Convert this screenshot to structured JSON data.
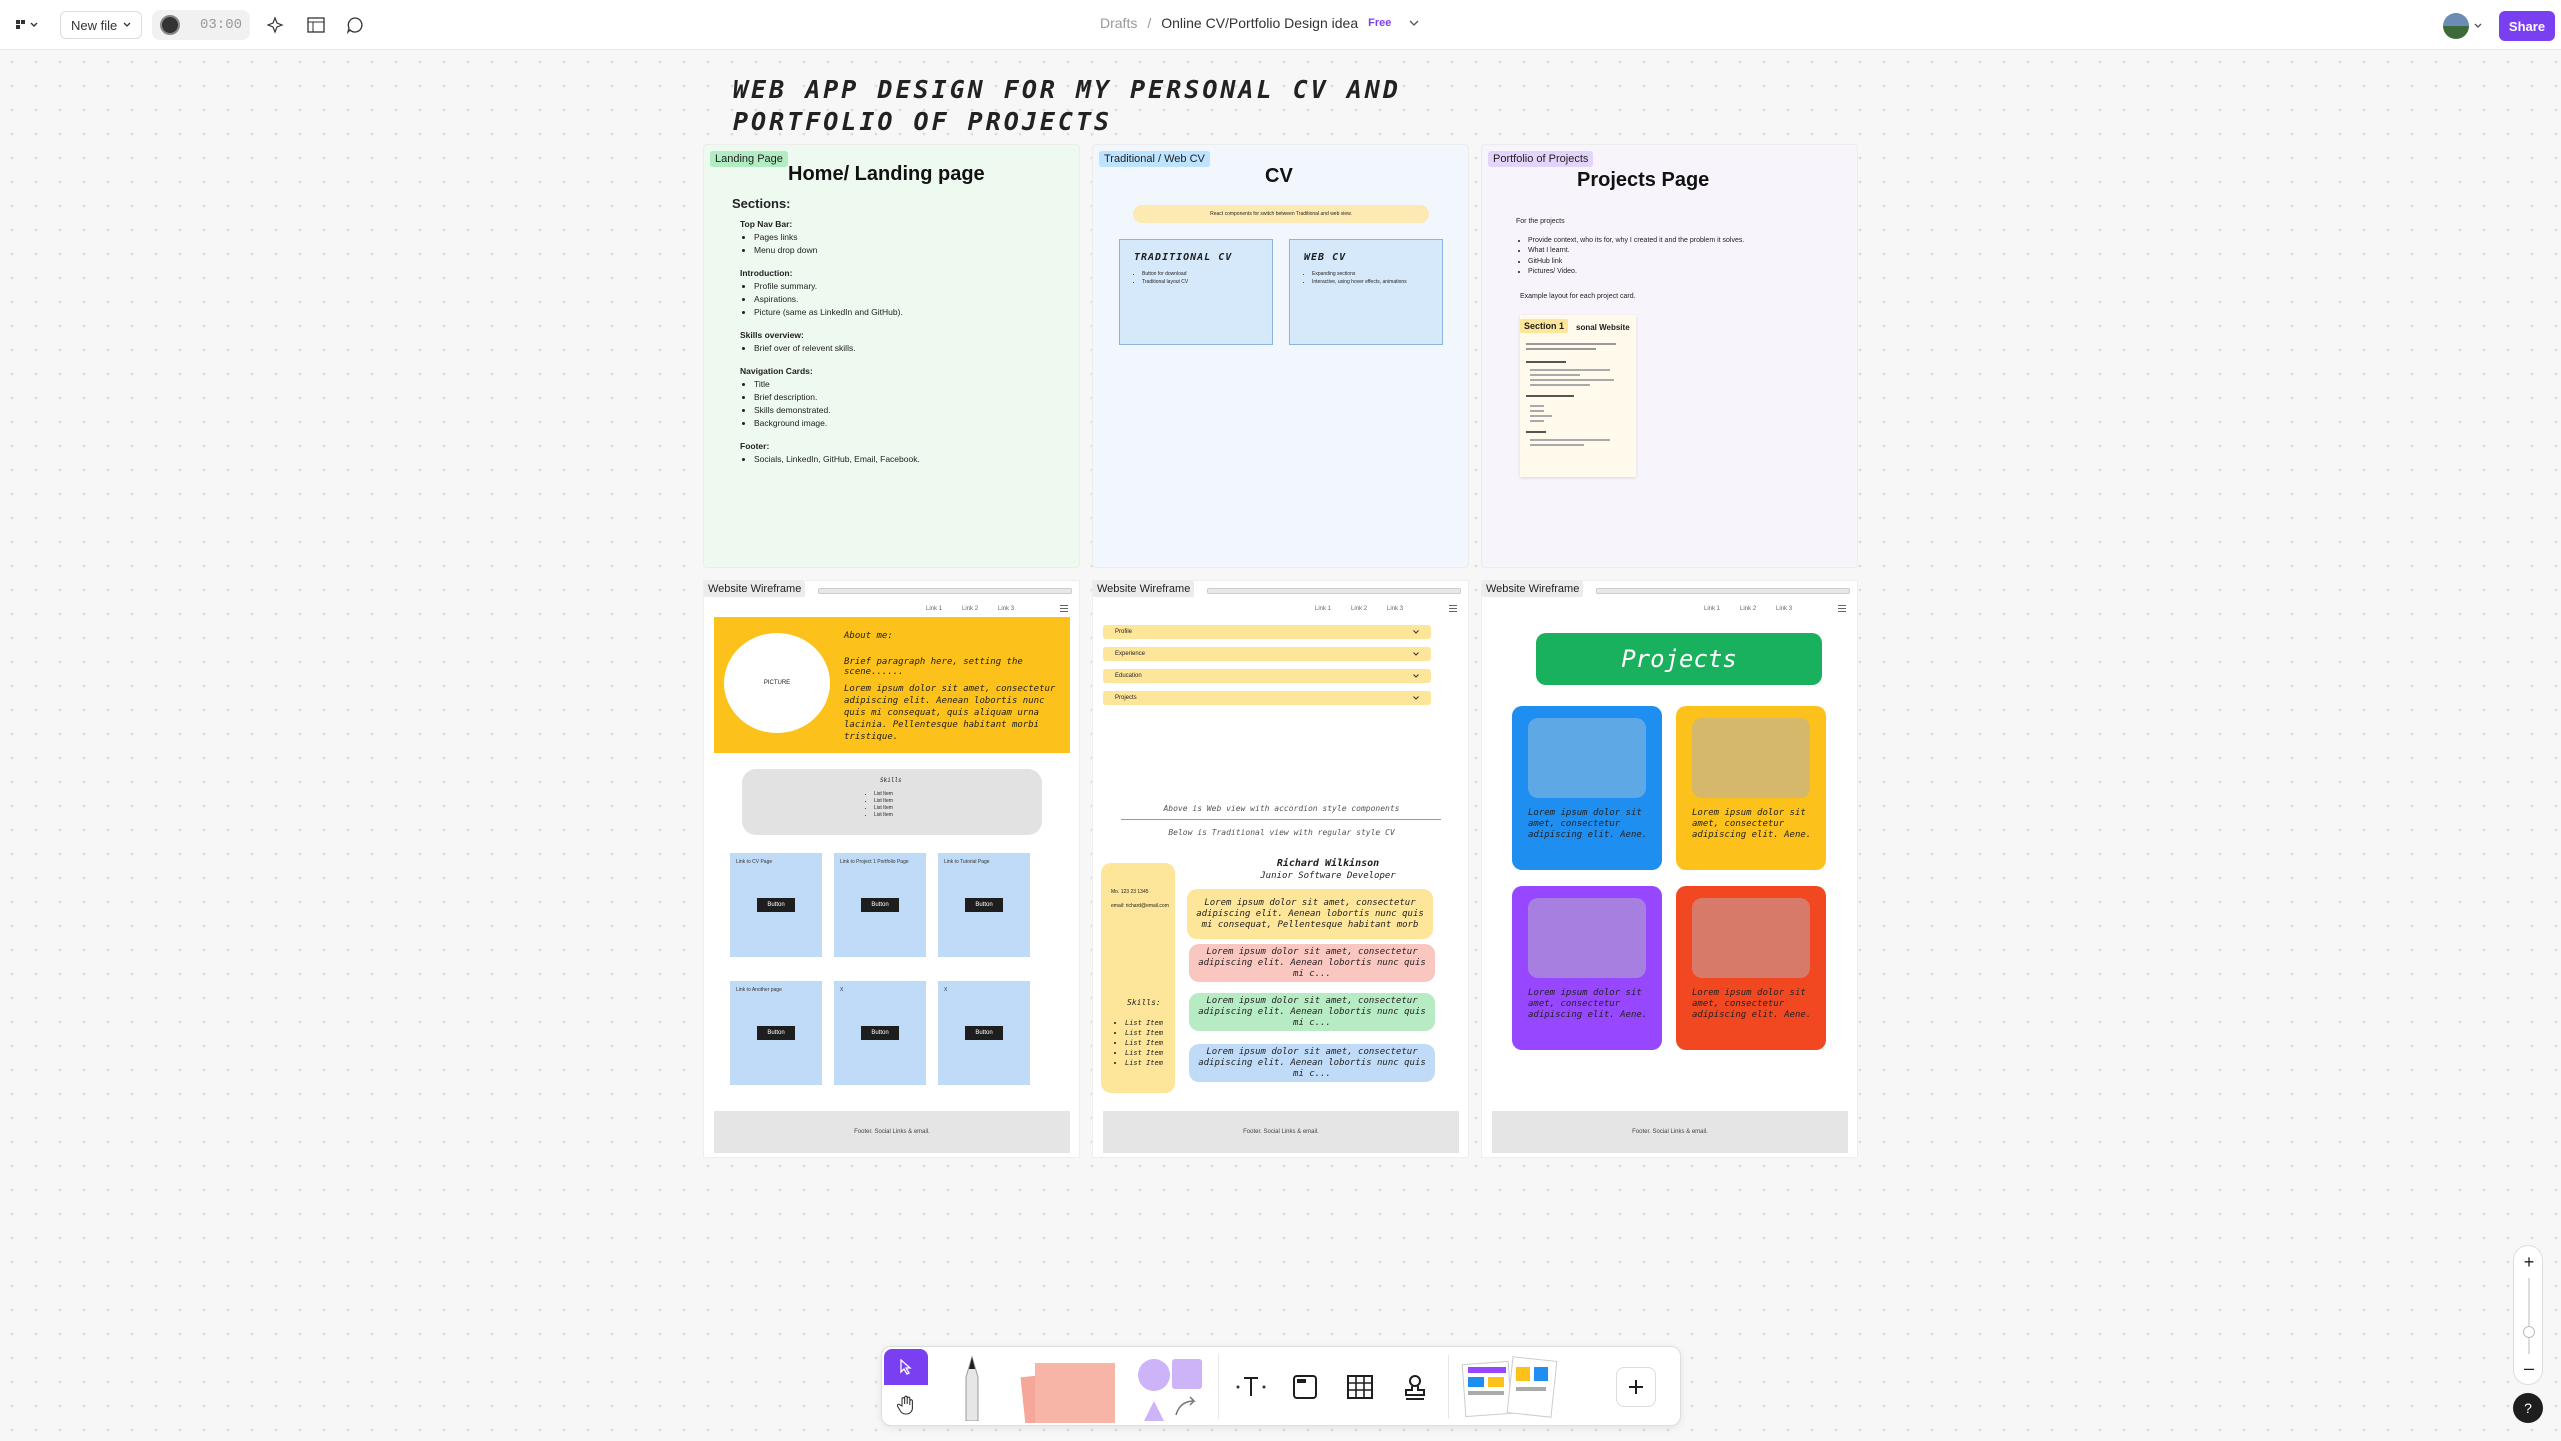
{
  "topbar": {
    "new_file_label": "New file",
    "timer": "03:00",
    "breadcrumb_root": "Drafts",
    "breadcrumb_sep": "/",
    "file_name": "Online CV/Portfolio Design idea",
    "plan_badge": "Free",
    "share_label": "Share"
  },
  "canvas": {
    "title": "WEB APP DESIGN FOR MY PERSONAL CV AND PORTFOLIO OF PROJECTS",
    "landing": {
      "tag": "Landing Page",
      "title": "Home/ Landing page",
      "sections_heading": "Sections:",
      "groups": [
        {
          "heading": "Top Nav Bar:",
          "items": [
            "Pages links",
            "Menu drop down"
          ]
        },
        {
          "heading": "Introduction:",
          "items": [
            "Profile summary.",
            "Aspirations.",
            "Picture (same as LinkedIn and GitHub)."
          ]
        },
        {
          "heading": "Skills overview:",
          "items": [
            "Brief over of relevent skills."
          ]
        },
        {
          "heading": "Navigation Cards:",
          "items": [
            "Title",
            "Brief description.",
            "Skills demonstrated.",
            "Background image."
          ]
        },
        {
          "heading": "Footer:",
          "items": [
            "Socials, LinkedIn, GitHub, Email, Facebook."
          ]
        }
      ]
    },
    "cv": {
      "tag": "Traditional / Web CV",
      "title": "CV",
      "banner": "React components for switch between Traditional and web view.",
      "traditional": {
        "title": "TRADITIONAL CV",
        "items": [
          "Button for download",
          "Traditional layout CV"
        ]
      },
      "web": {
        "title": "WEB CV",
        "items": [
          "Expanding sections",
          "Interactive, using hover effects, animations"
        ]
      }
    },
    "projects": {
      "tag": "Portfolio of Projects",
      "title": "Projects Page",
      "intro": "For the projects",
      "items": [
        "Provide context, who its for, why I created it and the problem it solves.",
        "What I learnt.",
        "GitHub link",
        "Pictures/ Video."
      ],
      "example": "Example layout for each project card.",
      "card_tag": "Section 1",
      "card_title": "sonal Website"
    },
    "wf_home": {
      "tag": "Website Wireframe",
      "links": [
        "Link 1",
        "Link 2",
        "Link 3"
      ],
      "picture": "PICTURE",
      "about_title": "About me:",
      "about_line": "Brief paragraph here, setting the scene......",
      "lorem": "Lorem ipsum dolor sit amet, consectetur adipiscing elit. Aenean lobortis nunc quis mi consequat, quis aliquam urna lacinia. Pellentesque habitant morbi tristique.",
      "skills_title": "Skills",
      "skills": [
        "List Item",
        "List Item",
        "List Item",
        "List Item"
      ],
      "cards": [
        {
          "label": "Link to CV Page",
          "button": "Button"
        },
        {
          "label": "Link to Project 1 Portfolio Page",
          "button": "Button"
        },
        {
          "label": "Link to Tutorial Page",
          "button": "Button"
        },
        {
          "label": "Link to Another page",
          "button": "Button"
        },
        {
          "label": "X",
          "button": "Button"
        },
        {
          "label": "X",
          "button": "Button"
        }
      ],
      "footer": "Footer. Social Links & email."
    },
    "wf_cv": {
      "tag": "Website Wireframe",
      "links": [
        "Link 1",
        "Link 2",
        "Link 3"
      ],
      "accordion": [
        "Profile",
        "Experience",
        "Education",
        "Projects"
      ],
      "note_above": "Above is Web view with accordion style components",
      "note_below": "Below is Traditional view with regular style CV",
      "name": "Richard Wilkinson",
      "role": "Junior Software Developer",
      "phone": "Mo. 123 23 1345",
      "email": "email: richard@email.com",
      "skills_title": "Skills:",
      "skills": [
        "List Item",
        "List Item",
        "List Item",
        "List Item",
        "List Item"
      ],
      "blocks": [
        "Lorem ipsum dolor sit amet, consectetur adipiscing elit. Aenean lobortis nunc quis mi consequat, Pellentesque habitant morb",
        "Lorem ipsum dolor sit amet, consectetur adipiscing elit. Aenean lobortis nunc quis mi c...",
        "Lorem ipsum dolor sit amet, consectetur adipiscing elit. Aenean lobortis nunc quis mi c...",
        "Lorem ipsum dolor sit amet, consectetur adipiscing elit. Aenean lobortis nunc quis mi c..."
      ],
      "footer": "Footer. Social Links & email."
    },
    "wf_projects": {
      "tag": "Website Wireframe",
      "links": [
        "Link 1",
        "Link 2",
        "Link 3"
      ],
      "banner": "Projects",
      "card_text": "Lorem ipsum dolor sit amet, consectetur adipiscing elit. Aene.",
      "footer": "Footer. Social Links & email."
    }
  },
  "zoom": {
    "plus": "+",
    "minus": "–"
  },
  "help": "?",
  "colors": {
    "accent": "#7b3ff2",
    "landing": "#eef9ef",
    "cv": "#f1f7fd",
    "projects": "#f7f4fc",
    "yellow": "#fcc21b",
    "green": "#19b15d"
  }
}
